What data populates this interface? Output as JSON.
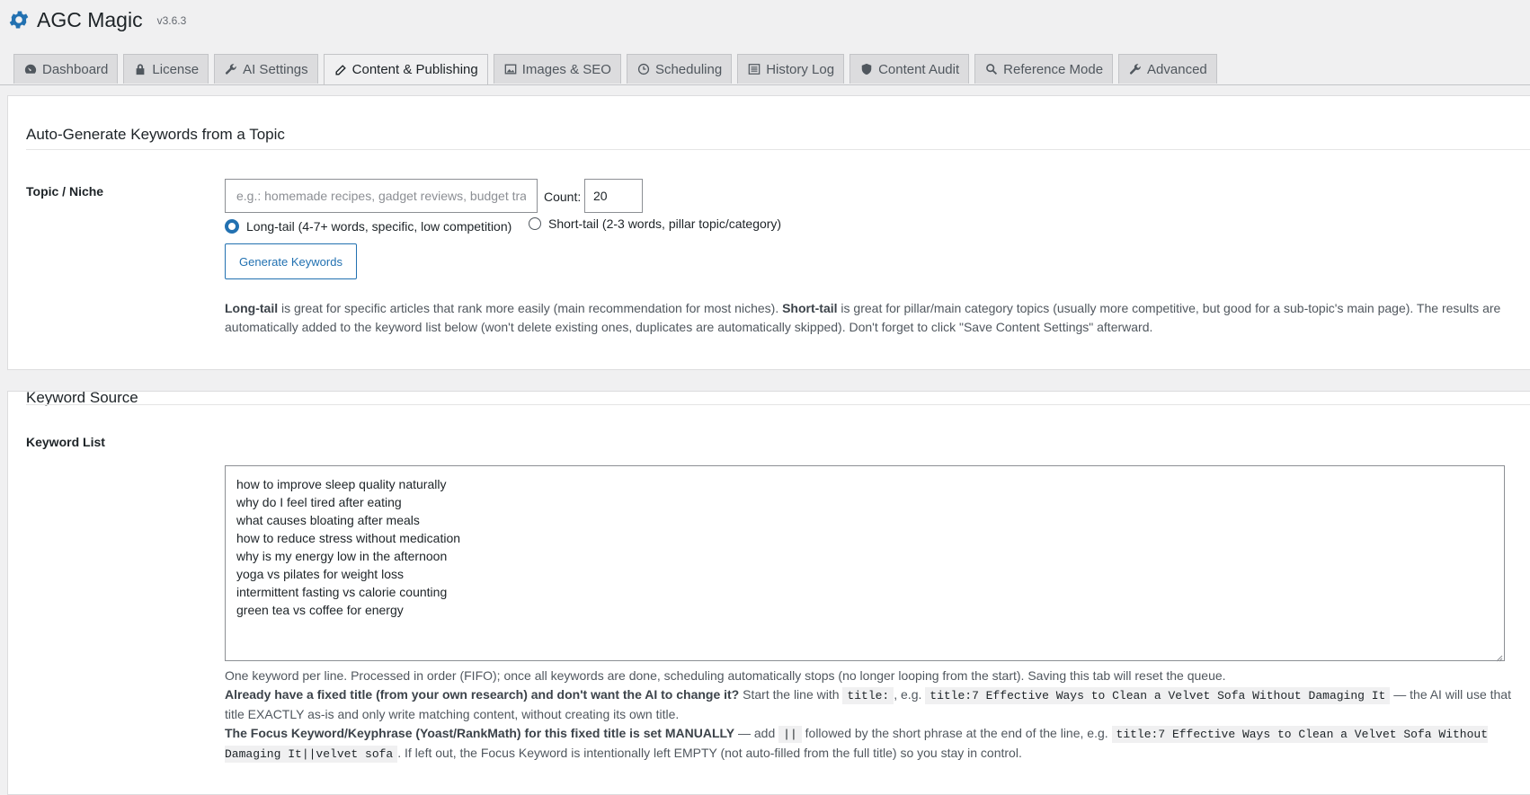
{
  "app": {
    "title": "AGC Magic",
    "version": "v3.6.3",
    "icon": "gear-icon",
    "accent": "#2271b1"
  },
  "tabs": [
    {
      "label": "Dashboard",
      "icon": "dashboard-icon",
      "active": false
    },
    {
      "label": "License",
      "icon": "lock-icon",
      "active": false
    },
    {
      "label": "AI Settings",
      "icon": "wrench-icon",
      "active": false
    },
    {
      "label": "Content & Publishing",
      "icon": "pencil-icon",
      "active": true
    },
    {
      "label": "Images & SEO",
      "icon": "image-icon",
      "active": false
    },
    {
      "label": "Scheduling",
      "icon": "clock-icon",
      "active": false
    },
    {
      "label": "History Log",
      "icon": "list-icon",
      "active": false
    },
    {
      "label": "Content Audit",
      "icon": "shield-icon",
      "active": false
    },
    {
      "label": "Reference Mode",
      "icon": "search-icon",
      "active": false
    },
    {
      "label": "Advanced",
      "icon": "wrench-icon",
      "active": false
    }
  ],
  "autogen": {
    "heading": "Auto-Generate Keywords from a Topic",
    "topic_label": "Topic / Niche",
    "topic_placeholder": "e.g.: homemade recipes, gadget reviews, budget travel",
    "topic_value": "",
    "count_label": "Count:",
    "count_value": "20",
    "radio_longtail": "Long-tail (4-7+ words, specific, low competition)",
    "radio_shorttail": "Short-tail (2-3 words, pillar topic/category)",
    "selected": "longtail",
    "button": "Generate Keywords",
    "desc_b1": "Long-tail",
    "desc_t1": " is great for specific articles that rank more easily (main recommendation for most niches). ",
    "desc_b2": "Short-tail",
    "desc_t2": " is great for pillar/main category topics (usually more competitive, but good for a sub-topic's main page). The results are automatically added to the keyword list below (won't delete existing ones, duplicates are automatically skipped). Don't forget to click \"Save Content Settings\" afterward."
  },
  "source": {
    "heading": "Keyword Source",
    "list_label": "Keyword List",
    "keywords": [
      "how to improve sleep quality naturally",
      "why do I feel tired after eating",
      "what causes bloating after meals",
      "how to reduce stress without medication",
      "why is my energy low in the afternoon",
      "yoga vs pilates for weight loss",
      "intermittent fasting vs calorie counting",
      "green tea vs coffee for energy"
    ],
    "help1": "One keyword per line. Processed in order (FIFO); once all keywords are done, scheduling automatically stops (no longer looping from the start). Saving this tab will reset the queue.",
    "help2_b": "Already have a fixed title (from your own research) and don't want the AI to change it?",
    "help2_t1": " Start the line with ",
    "help2_code1": "title:",
    "help2_t2": ", e.g. ",
    "help2_code2": "title:7 Effective Ways to Clean a Velvet Sofa Without Damaging It",
    "help2_t3": " — the AI will use that title EXACTLY as-is and only write matching content, without creating its own title.",
    "help3_b": "The Focus Keyword/Keyphrase (Yoast/RankMath) for this fixed title is set MANUALLY",
    "help3_t1": " — add ",
    "help3_code1": "||",
    "help3_t2": " followed by the short phrase at the end of the line, e.g. ",
    "help3_code2": "title:7 Effective Ways to Clean a Velvet Sofa Without Damaging It||velvet sofa",
    "help3_t3": ". If left out, the Focus Keyword is intentionally left EMPTY (not auto-filled from the full title) so you stay in control."
  }
}
